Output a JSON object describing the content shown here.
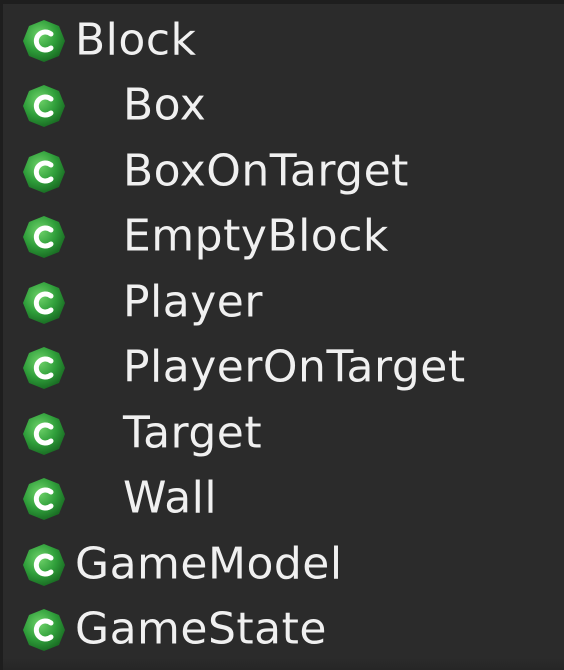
{
  "tree": {
    "items": [
      {
        "label": "Block",
        "level": 0,
        "icon": "class-icon"
      },
      {
        "label": "Box",
        "level": 1,
        "icon": "class-icon"
      },
      {
        "label": "BoxOnTarget",
        "level": 1,
        "icon": "class-icon"
      },
      {
        "label": "EmptyBlock",
        "level": 1,
        "icon": "class-icon"
      },
      {
        "label": "Player",
        "level": 1,
        "icon": "class-icon"
      },
      {
        "label": "PlayerOnTarget",
        "level": 1,
        "icon": "class-icon"
      },
      {
        "label": "Target",
        "level": 1,
        "icon": "class-icon"
      },
      {
        "label": "Wall",
        "level": 1,
        "icon": "class-icon"
      },
      {
        "label": "GameModel",
        "level": 0,
        "icon": "class-icon"
      },
      {
        "label": "GameState",
        "level": 0,
        "icon": "class-icon"
      }
    ]
  },
  "colors": {
    "background": "#2b2b2b",
    "text": "#f0f0f0",
    "icon_green": "#2f9e3a",
    "icon_letter": "#ffffff"
  }
}
